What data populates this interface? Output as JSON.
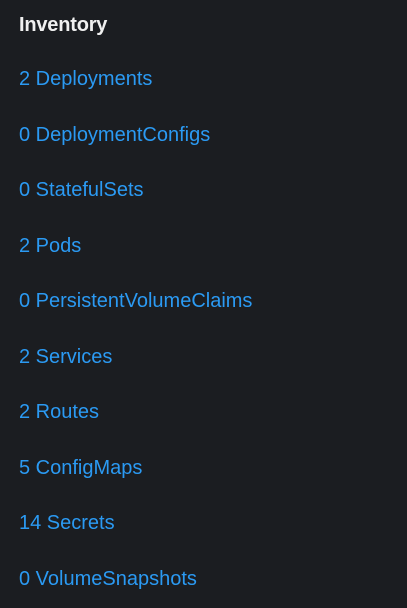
{
  "inventory": {
    "title": "Inventory",
    "items": [
      {
        "label": "2 Deployments"
      },
      {
        "label": "0 DeploymentConfigs"
      },
      {
        "label": "0 StatefulSets"
      },
      {
        "label": "2 Pods"
      },
      {
        "label": "0 PersistentVolumeClaims"
      },
      {
        "label": "2 Services"
      },
      {
        "label": "2 Routes"
      },
      {
        "label": "5 ConfigMaps"
      },
      {
        "label": "14 Secrets"
      },
      {
        "label": "0 VolumeSnapshots"
      }
    ]
  },
  "colors": {
    "background": "#1b1d21",
    "title": "#f0f0f0",
    "link": "#2b9af3"
  }
}
